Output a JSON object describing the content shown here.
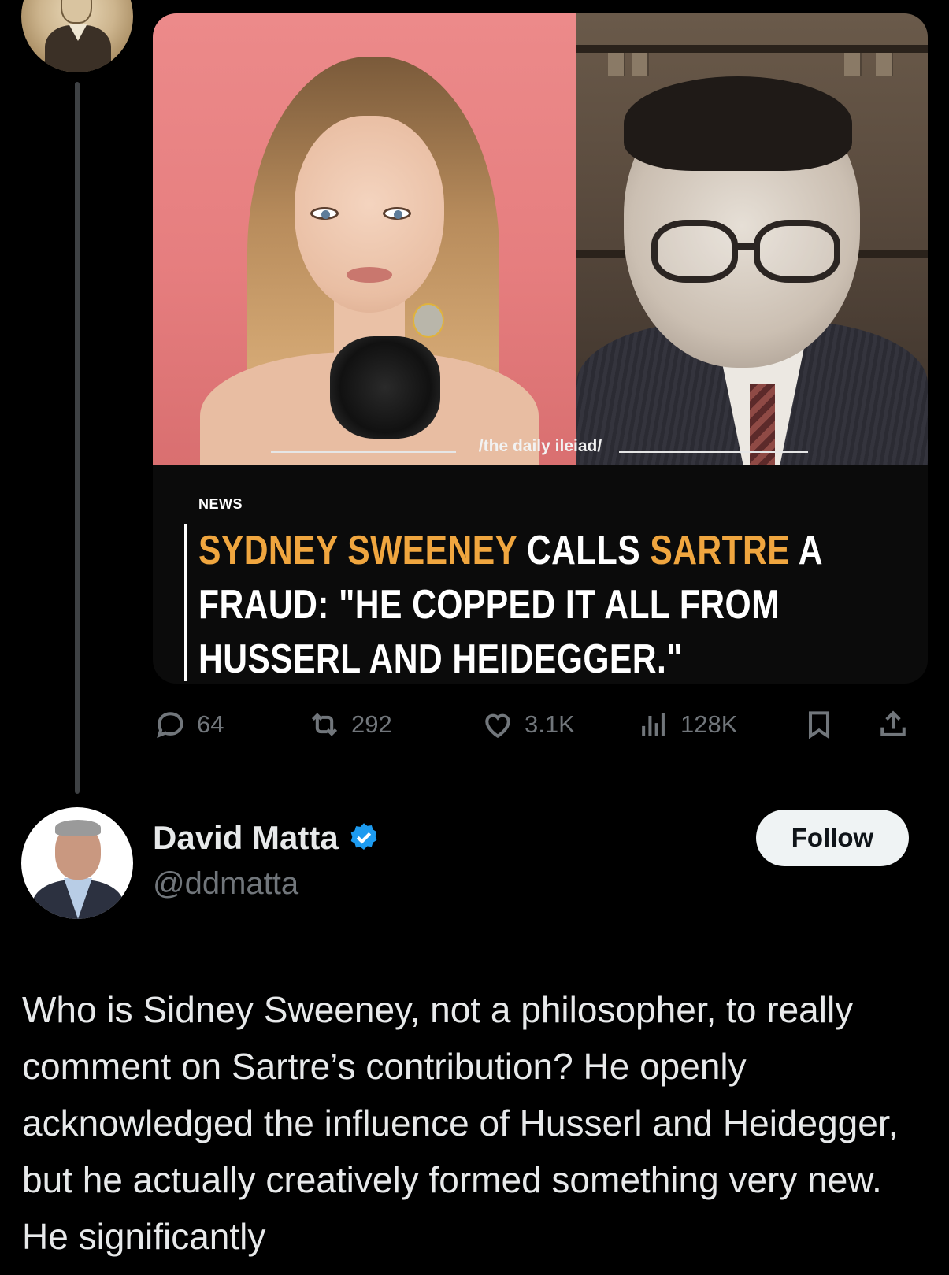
{
  "media": {
    "brand": "/the daily ileiad/",
    "section_label": "NEWS",
    "headline": {
      "line1_a": "SYDNEY SWEENEY",
      "line1_b": "CALLS",
      "line1_c": "SARTRE",
      "line1_d": "A",
      "line2": "FRAUD: \"HE COPPED IT ALL FROM",
      "line3": "HUSSERL AND HEIDEGGER.\""
    },
    "highlight_color": "#f0a63f"
  },
  "actions": {
    "reply_count": "64",
    "repost_count": "292",
    "like_count": "3.1K",
    "view_count": "128K"
  },
  "reply": {
    "display_name": "David Matta",
    "handle": "@ddmatta",
    "follow_label": "Follow",
    "text": "Who is Sidney Sweeney, not a philosopher, to really comment on Sartre’s contribution? He openly acknowledged the influence of Husserl and Heidegger, but he actually creatively formed something very new. He significantly"
  },
  "colors": {
    "background": "#000000",
    "muted": "#71767b",
    "verified": "#1d9bf0"
  }
}
